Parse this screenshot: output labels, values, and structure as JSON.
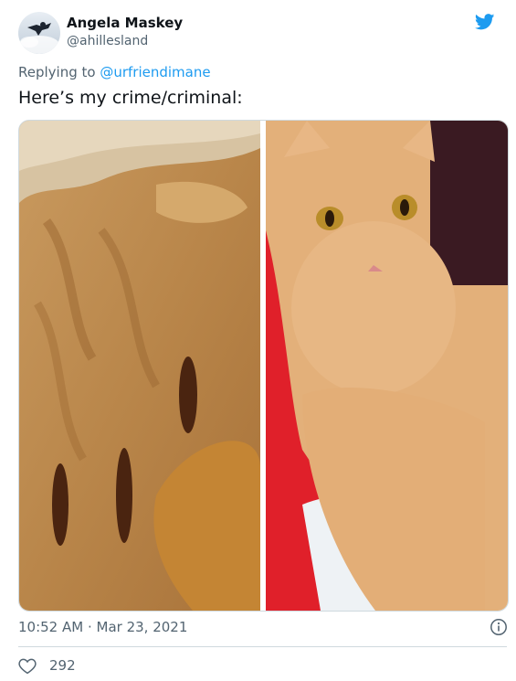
{
  "tweet": {
    "author": {
      "display_name": "Angela Maskey",
      "handle": "@ahillesland"
    },
    "reply": {
      "prefix": "Replying to ",
      "mention": "@urfriendimane"
    },
    "text": "Here’s my crime/criminal:",
    "timestamp": "10:52 AM · Mar 23, 2021",
    "likes": "292"
  },
  "icons": {
    "brand": "twitter-bird-icon",
    "info": "info-icon",
    "like": "heart-icon"
  },
  "colors": {
    "accent": "#1d9bf0",
    "secondary_text": "#536471",
    "divider": "#cfd9de"
  }
}
